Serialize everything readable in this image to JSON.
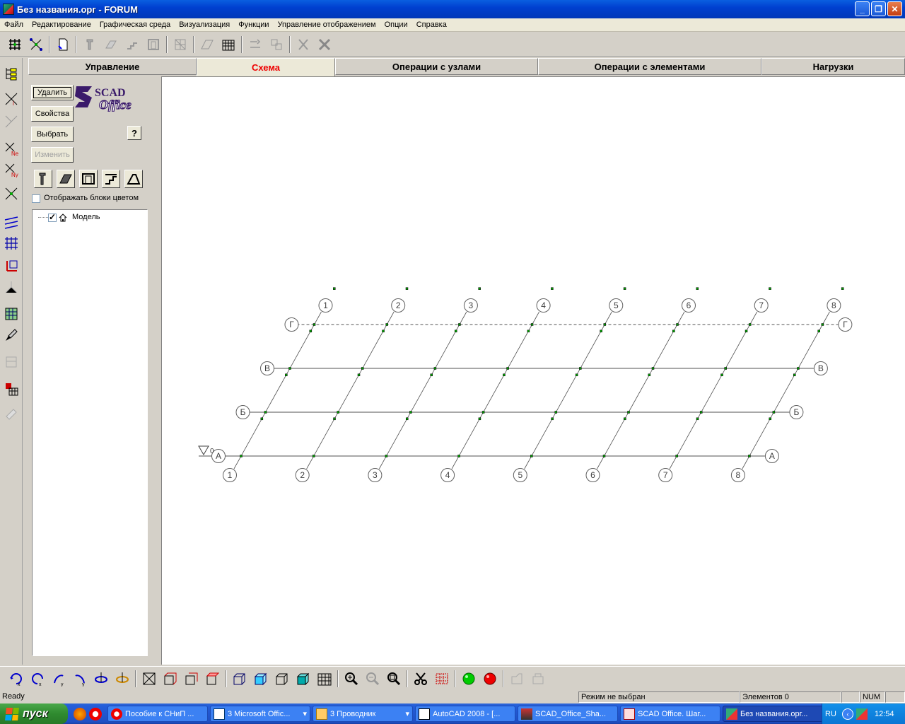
{
  "window": {
    "title": "Без названия.орг - FORUM",
    "minimize": "_",
    "restore": "❐",
    "close": "✕"
  },
  "menu": [
    "Файл",
    "Редактирование",
    "Графическая среда",
    "Визуализация",
    "Функции",
    "Управление отображением",
    "Опции",
    "Справка"
  ],
  "tabs": [
    "Управление",
    "Схема",
    "Операции с узлами",
    "Операции с элементами",
    "Нагрузки"
  ],
  "active_tab": "Схема",
  "panel": {
    "delete_button": "Удалить",
    "properties_button": "Свойства",
    "select_button": "Выбрать",
    "edit_button": "Изменить",
    "help_button": "?",
    "logo_top": "SCAD",
    "logo_bottom": "Office",
    "show_blocks_color_label": "Отображать блоки цветом",
    "show_blocks_color_checked": false,
    "tree_root_label": "Модель",
    "tree_root_checked": true
  },
  "grid": {
    "columns": [
      "1",
      "2",
      "3",
      "4",
      "5",
      "6",
      "7",
      "8"
    ],
    "rows": [
      "А",
      "Б",
      "В",
      "Г"
    ],
    "level_marker": "0"
  },
  "status": {
    "ready": "Ready",
    "mode": "Режим не выбран",
    "elements": "Элементов 0",
    "num": "NUM"
  },
  "taskbar": {
    "start": "пуск",
    "tasks": [
      "Пособие к СНиП ...",
      "3 Microsoft Offic...",
      "3 Проводник",
      "AutoCAD 2008 - [...",
      "SCAD_Office_Sha...",
      "SCAD Office. Шаг...",
      "Без названия.орг..."
    ],
    "language": "RU",
    "clock": "12:54"
  },
  "colors": {
    "accent_tab": "#e00000",
    "node": "#00a000",
    "titlebar": "#0a5fe0"
  }
}
